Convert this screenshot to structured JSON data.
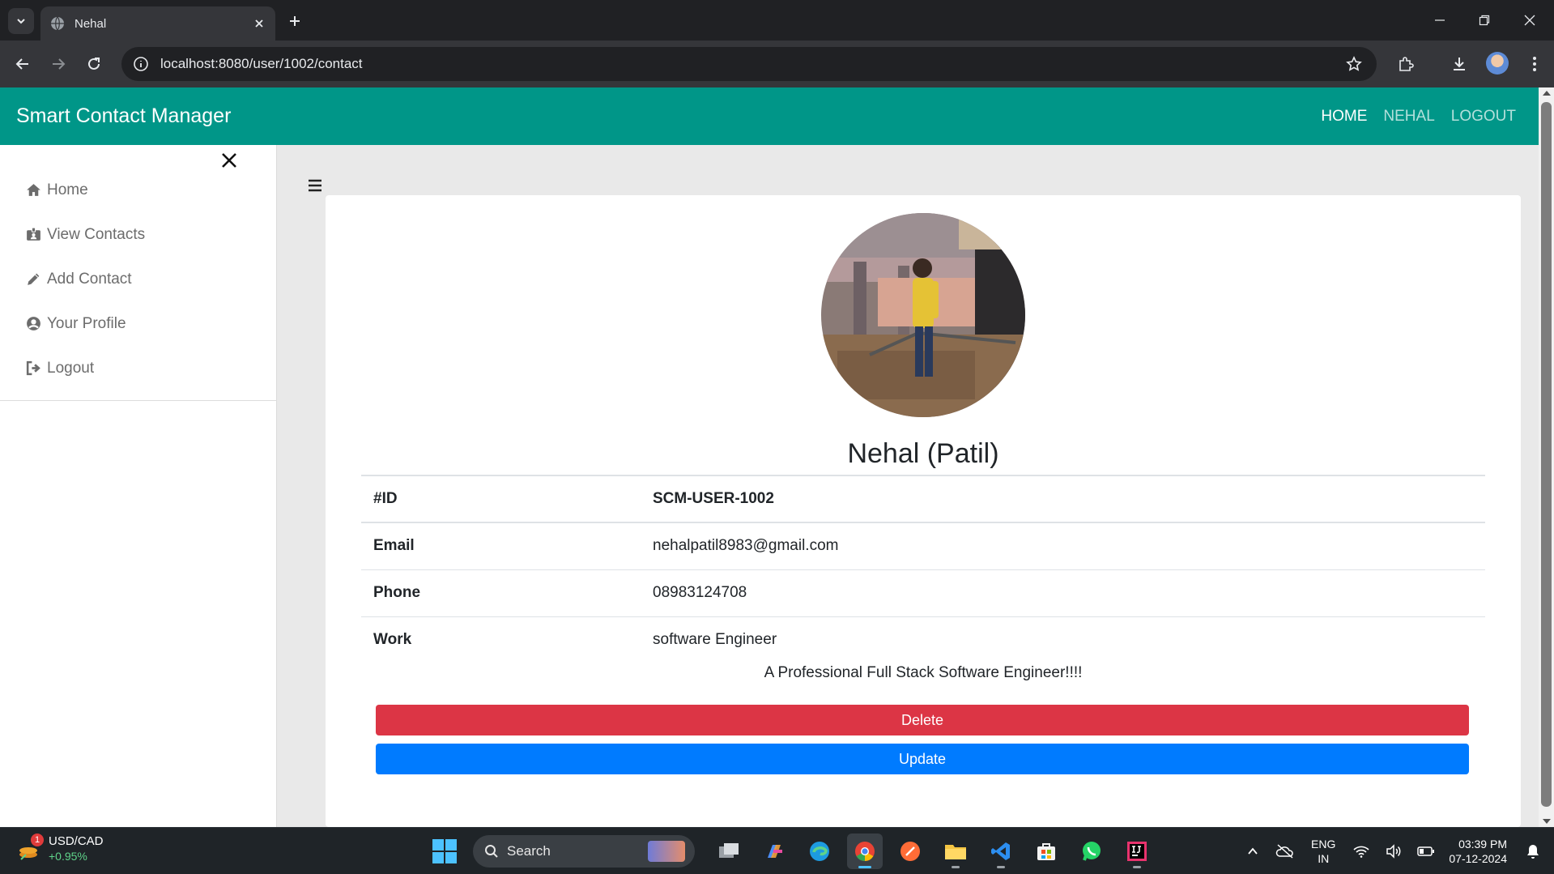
{
  "browser": {
    "tab_title": "Nehal",
    "url": "localhost:8080/user/1002/contact"
  },
  "app": {
    "brand": "Smart Contact Manager",
    "nav": [
      "HOME",
      "NEHAL",
      "LOGOUT"
    ]
  },
  "sidebar": {
    "items": [
      {
        "label": "Home",
        "icon": "home-icon"
      },
      {
        "label": "View Contacts",
        "icon": "id-badge-icon"
      },
      {
        "label": "Add Contact",
        "icon": "pencil-icon"
      },
      {
        "label": "Your Profile",
        "icon": "user-circle-icon"
      },
      {
        "label": "Logout",
        "icon": "sign-out-icon"
      }
    ]
  },
  "contact": {
    "name": "Nehal (Patil)",
    "rows": [
      {
        "key": "#ID",
        "value": "SCM-USER-1002"
      },
      {
        "key": "Email",
        "value": "nehalpatil8983@gmail.com"
      },
      {
        "key": "Phone",
        "value": "08983124708"
      },
      {
        "key": "Work",
        "value": "software Engineer"
      }
    ],
    "description": "A Professional Full Stack Software Engineer!!!!",
    "delete_label": "Delete",
    "update_label": "Update"
  },
  "taskbar": {
    "widget_symbol": "USD/CAD",
    "widget_change": "+0.95%",
    "widget_badge": "1",
    "search_label": "Search",
    "lang_1": "ENG",
    "lang_2": "IN",
    "time": "03:39 PM",
    "date": "07-12-2024"
  },
  "colors": {
    "primary": "#009688",
    "delete": "#dc3545",
    "update": "#007bff"
  }
}
